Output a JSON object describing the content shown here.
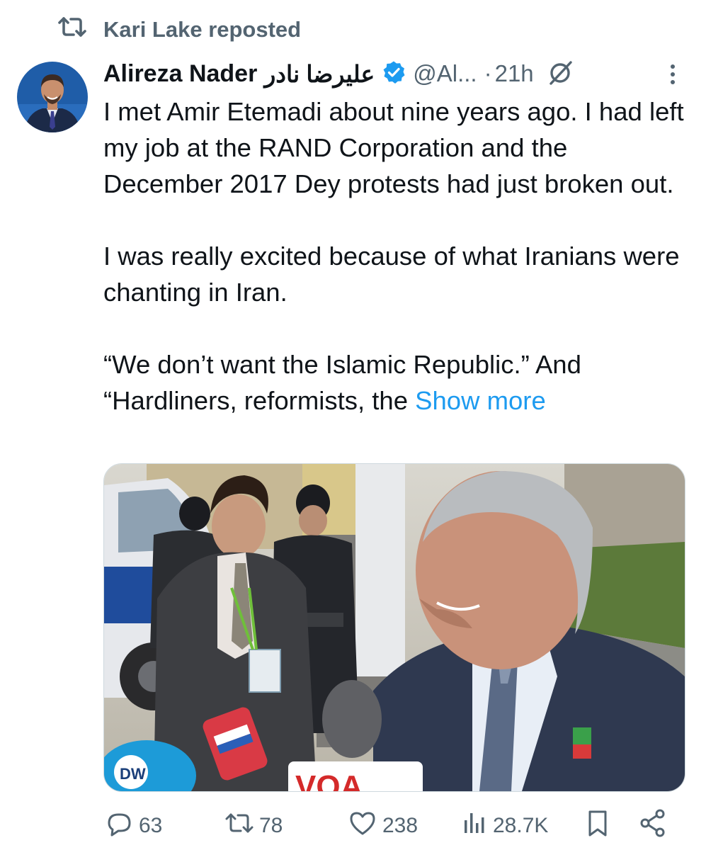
{
  "repost": {
    "label": "Kari Lake reposted",
    "icon": "repost-icon"
  },
  "author": {
    "name": "Alireza Nader",
    "name_fa": "علیرضا نادر",
    "handle": "@Al...",
    "separator": "·",
    "time": "21h",
    "verified": true
  },
  "tweet": {
    "text": "I met Amir Etemadi about nine years ago. I had left my job at the RAND Corporation and the December 2017 Dey protests had just broken out.\n\nI was really excited because of what Iranians were chanting in Iran.\n\n“We don’t want the Islamic Republic.” And “Hardliners, reformists, the ",
    "show_more": "Show more"
  },
  "media": {
    "microphone_labels": [
      "VOA",
      "DW"
    ]
  },
  "actions": {
    "replies": "63",
    "reposts": "78",
    "likes": "238",
    "views": "28.7K"
  },
  "colors": {
    "accent": "#1d9bf0",
    "secondary_text": "#536471",
    "primary_text": "#0f1419"
  }
}
